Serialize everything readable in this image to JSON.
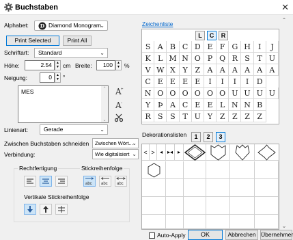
{
  "window": {
    "title": "Buchstaben"
  },
  "alphabet": {
    "label": "Alphabet:",
    "value": "Diamond Monogram"
  },
  "buttons": {
    "print_selected": "Print Selected",
    "print_all": "Print All"
  },
  "font_type": {
    "label": "Schriftart:",
    "value": "Standard"
  },
  "height": {
    "label": "Höhe:",
    "value": "2.54",
    "unit": "cm"
  },
  "width": {
    "label": "Breite:",
    "value": "100",
    "unit": "%"
  },
  "slant": {
    "label": "Neigung:",
    "value": "0",
    "unit": "°"
  },
  "text_box": {
    "value": "MES"
  },
  "line_type": {
    "label": "Linienart:",
    "value": "Gerade"
  },
  "cut_between": {
    "label": "Zwischen Buchstaben schneiden",
    "value": "Zwischen Wört..."
  },
  "connection": {
    "label": "Verbindung:",
    "value": "Wie digitalisiert"
  },
  "justification": {
    "label": "Rechtfertigung"
  },
  "stitch_order": {
    "label": "Stickreihenfolge"
  },
  "vertical_order": {
    "label": "Vertikale Stickreihenfolge"
  },
  "char_list": {
    "label": "Zeichenliste",
    "tabs": [
      "L",
      "C",
      "R"
    ],
    "active_tab": "C",
    "rows": [
      [
        "S",
        "A",
        "B",
        "C",
        "D",
        "E",
        "F",
        "G",
        "H",
        "I",
        "J"
      ],
      [
        "K",
        "L",
        "M",
        "N",
        "O",
        "P",
        "Q",
        "R",
        "S",
        "T",
        "U"
      ],
      [
        "V",
        "W",
        "X",
        "Y",
        "Z",
        "A",
        "A",
        "A",
        "A",
        "A",
        "A"
      ],
      [
        "C",
        "E",
        "E",
        "E",
        "E",
        "I",
        "I",
        "I",
        "I",
        "D"
      ],
      [
        "N",
        "O",
        "O",
        "O",
        "O",
        "O",
        "O",
        "U",
        "U",
        "U",
        "U"
      ],
      [
        "Y",
        "Þ",
        "A",
        "C",
        "E",
        "E",
        "L",
        "N",
        "N",
        "B"
      ],
      [
        "R",
        "S",
        "S",
        "T",
        "U",
        "Y",
        "Z",
        "Z",
        "Z",
        "Z"
      ]
    ]
  },
  "deco_list": {
    "label": "Dekorationslisten",
    "tabs": [
      "1",
      "2",
      "3"
    ],
    "active_tab": "3"
  },
  "footer": {
    "auto_apply": "Auto-Apply",
    "ok": "OK",
    "cancel": "Abbrechen",
    "apply": "Übernehmen"
  }
}
